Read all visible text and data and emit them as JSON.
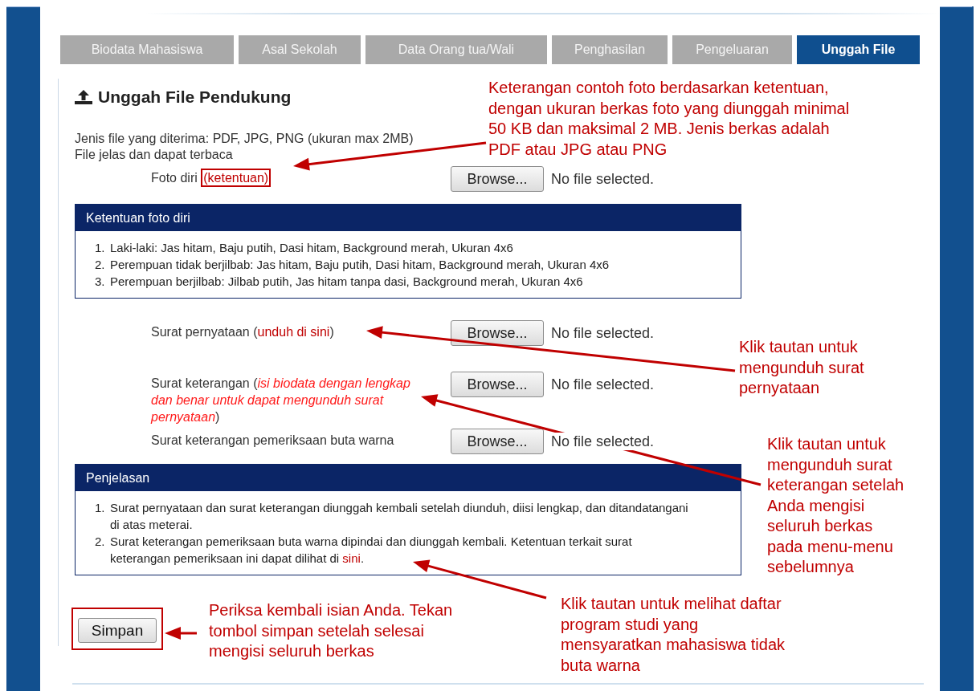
{
  "tabs": [
    {
      "label": "Biodata Mahasiswa",
      "selected": false
    },
    {
      "label": "Asal Sekolah",
      "selected": false
    },
    {
      "label": "Data Orang tua/Wali",
      "selected": false
    },
    {
      "label": "Penghasilan",
      "selected": false
    },
    {
      "label": "Pengeluaran",
      "selected": false
    },
    {
      "label": "Unggah File",
      "selected": true
    }
  ],
  "title": "Unggah File Pendukung",
  "info_lines": [
    "Jenis file yang diterima: PDF, JPG, PNG (ukuran max 2MB)",
    "File jelas dan dapat terbaca"
  ],
  "upload_rows": [
    {
      "kind": "boxed",
      "prefix": "Foto diri ",
      "link": "(ketentuan)",
      "suffix": "",
      "button": "Browse...",
      "status": "No file selected."
    },
    {
      "kind": "link",
      "prefix": "Surat pernyataan (",
      "link": "unduh di sini",
      "suffix": ")",
      "button": "Browse...",
      "status": "No file selected."
    },
    {
      "kind": "note",
      "prefix": "Surat keterangan (",
      "link": "isi biodata dengan lengkap dan benar untuk dapat mengunduh surat pernyataan",
      "suffix": ")",
      "button": "Browse...",
      "status": "No file selected."
    },
    {
      "kind": "plain",
      "prefix": "Surat keterangan pemeriksaan buta warna",
      "button": "Browse...",
      "status": "No file selected."
    }
  ],
  "rules_panel": {
    "title": "Ketentuan foto diri",
    "items": [
      {
        "marker": "1.",
        "text": "Laki-laki: Jas hitam, Baju putih, Dasi hitam, Background merah, Ukuran 4x6"
      },
      {
        "marker": "2.",
        "text": "Perempuan tidak berjilbab: Jas hitam, Baju putih, Dasi hitam, Background merah, Ukuran 4x6"
      },
      {
        "marker": "3.",
        "text": "Perempuan berjilbab: Jilbab putih, Jas hitam tanpa dasi, Background merah, Ukuran 4x6"
      }
    ]
  },
  "explanation_panel": {
    "title": "Penjelasan",
    "items": [
      {
        "marker": "1.",
        "text": "Surat pernyataan dan surat keterangan diunggah kembali setelah diunduh, diisi lengkap, dan ditandatangani di atas meterai."
      },
      {
        "marker": "2.",
        "text": "Surat keterangan pemeriksaan buta warna dipindai dan diunggah kembali. Ketentuan terkait surat keterangan pemeriksaan ini dapat dilihat di ",
        "link": "sini",
        "end": "."
      }
    ]
  },
  "save_button": "Simpan",
  "callouts": [
    "Keterangan contoh foto berdasarkan ketentuan,\ndengan ukuran berkas foto yang diunggah minimal\n50 KB dan maksimal 2 MB. Jenis berkas adalah\nPDF atau JPG atau PNG",
    "Klik tautan untuk\nmengunduh surat\npernyataan",
    "Klik tautan untuk\nmengunduh surat\nketerangan setelah\nAnda mengisi\nseluruh berkas\npada menu-menu\nsebelumnya",
    "Periksa kembali isian Anda. Tekan\ntombol simpan setelah selesai\nmengisi seluruh berkas",
    "Klik tautan untuk melihat daftar\nprogram studi yang\nmensyaratkan mahasiswa tidak\nbuta warna"
  ]
}
